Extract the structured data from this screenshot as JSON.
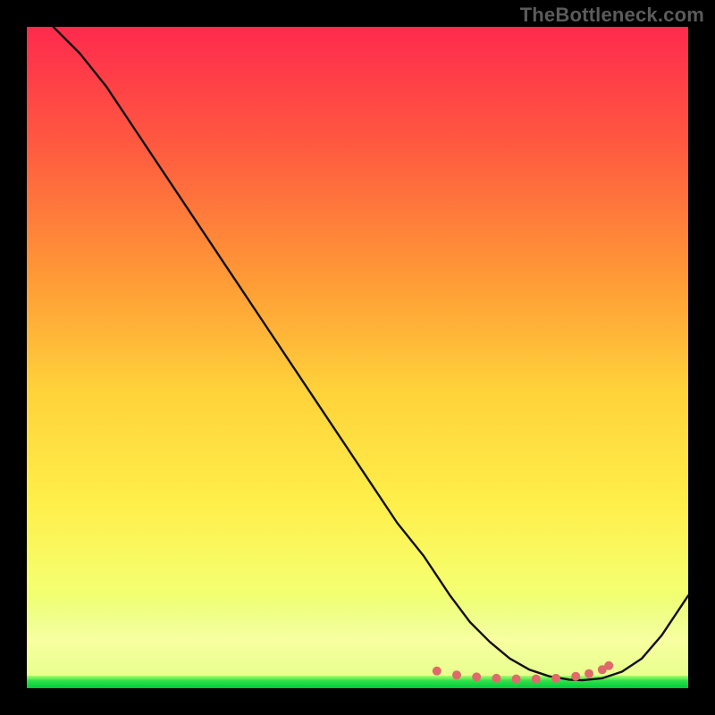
{
  "watermark": "TheBottleneck.com",
  "colors": {
    "gradient_top": "#ff2a4d",
    "gradient_mid_upper": "#ff6a3c",
    "gradient_mid": "#ffb536",
    "gradient_mid_lower": "#ffe24a",
    "gradient_lower": "#f3ff6b",
    "gradient_bottom": "#00c93a",
    "curve": "#111111",
    "dots": "#e06a6a"
  },
  "chart_data": {
    "type": "line",
    "title": "",
    "xlabel": "",
    "ylabel": "",
    "xlim": [
      0,
      100
    ],
    "ylim": [
      0,
      100
    ],
    "series": [
      {
        "name": "curve",
        "x": [
          4,
          8,
          12,
          16,
          20,
          24,
          28,
          32,
          36,
          40,
          44,
          48,
          52,
          56,
          60,
          62,
          64,
          67,
          70,
          73,
          76,
          79,
          82,
          84,
          87,
          90,
          93,
          96,
          100
        ],
        "y": [
          100,
          96,
          91,
          85,
          79,
          73,
          67,
          61,
          55,
          49,
          43,
          37,
          31,
          25,
          20,
          17,
          14,
          10,
          7,
          4.5,
          2.8,
          1.8,
          1.3,
          1.2,
          1.5,
          2.5,
          4.5,
          8,
          14
        ]
      }
    ],
    "dots": {
      "x": [
        62,
        65,
        68,
        71,
        74,
        77,
        80,
        83,
        85,
        87,
        88
      ],
      "y": [
        2.6,
        2.0,
        1.7,
        1.5,
        1.4,
        1.4,
        1.5,
        1.8,
        2.2,
        2.8,
        3.4
      ]
    }
  }
}
